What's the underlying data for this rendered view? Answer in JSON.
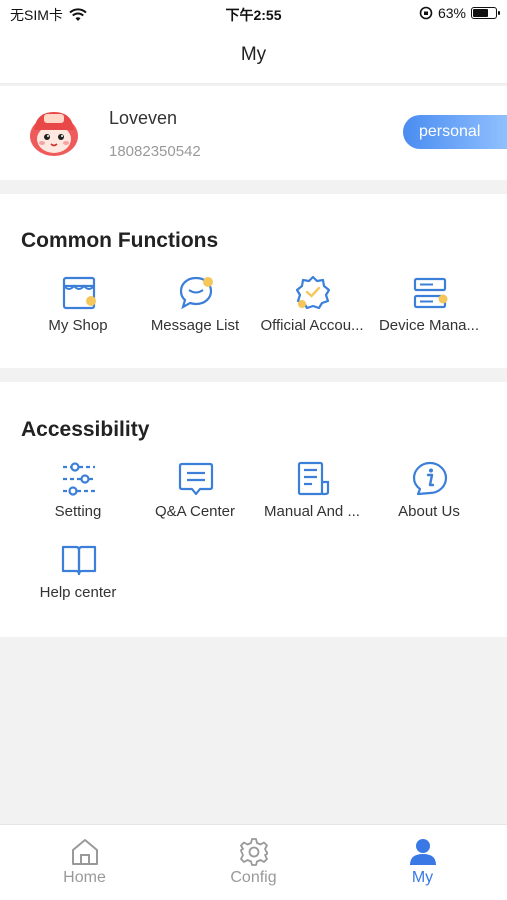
{
  "status_bar": {
    "carrier": "无SIM卡",
    "time": "下午2:55",
    "battery_percent": "63%",
    "battery_level": 0.63
  },
  "nav": {
    "title": "My"
  },
  "profile": {
    "name": "Loveven",
    "phone": "18082350542",
    "badge": "personal"
  },
  "common_functions": {
    "title": "Common Functions",
    "items": [
      {
        "label": "My Shop",
        "icon": "shop-icon"
      },
      {
        "label": "Message List",
        "icon": "message-bubble-icon"
      },
      {
        "label": "Official Accou...",
        "icon": "verified-badge-icon"
      },
      {
        "label": "Device Mana...",
        "icon": "device-server-icon"
      }
    ]
  },
  "accessibility": {
    "title": "Accessibility",
    "items": [
      {
        "label": "Setting",
        "icon": "sliders-icon"
      },
      {
        "label": "Q&A Center",
        "icon": "chat-box-icon"
      },
      {
        "label": "Manual And ...",
        "icon": "manual-document-icon"
      },
      {
        "label": "About Us",
        "icon": "info-icon"
      },
      {
        "label": "Help center",
        "icon": "open-book-icon"
      }
    ]
  },
  "tab_bar": {
    "tabs": [
      {
        "label": "Home",
        "icon": "home-icon",
        "active": false
      },
      {
        "label": "Config",
        "icon": "gear-icon",
        "active": false
      },
      {
        "label": "My",
        "icon": "person-icon",
        "active": true
      }
    ]
  },
  "colors": {
    "accent": "#3a78e6",
    "icon_blue": "#3b7fd9",
    "icon_dot": "#f5c75a",
    "badge_gradient_start": "#4a8cf0",
    "badge_gradient_end": "#8fc0ff",
    "inactive_tab": "#999999"
  }
}
